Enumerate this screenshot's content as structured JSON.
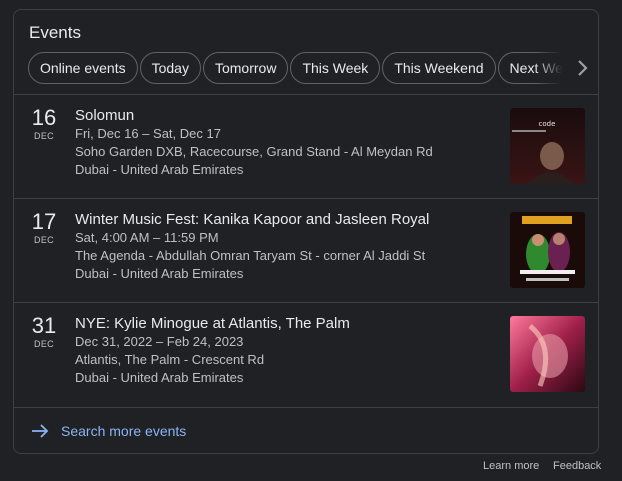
{
  "card": {
    "title": "Events"
  },
  "chips": [
    "Online events",
    "Today",
    "Tomorrow",
    "This Week",
    "This Weekend",
    "Next Week"
  ],
  "events": [
    {
      "day": "16",
      "month": "DEC",
      "title": "Solomun",
      "when": "Fri, Dec 16 – Sat, Dec 17",
      "venue": "Soho Garden DXB, Racecourse, Grand Stand - Al Meydan Rd",
      "city": "Dubai - United Arab Emirates",
      "image_text": "code"
    },
    {
      "day": "17",
      "month": "DEC",
      "title": "Winter Music Fest: Kanika Kapoor and Jasleen Royal",
      "when": "Sat, 4:00 AM – 11:59 PM",
      "venue": "The Agenda - Abdullah Omran Taryam St - corner Al Jaddi St",
      "city": "Dubai - United Arab Emirates"
    },
    {
      "day": "31",
      "month": "DEC",
      "title": "NYE: Kylie Minogue at Atlantis, The Palm",
      "when": "Dec 31, 2022 – Feb 24, 2023",
      "venue": "Atlantis, The Palm - Crescent Rd",
      "city": "Dubai - United Arab Emirates"
    }
  ],
  "search_more": "Search more events",
  "footer": {
    "learn_more": "Learn more",
    "feedback": "Feedback"
  },
  "colors": {
    "background": "#202124",
    "border": "#3c4043",
    "link": "#8ab4f8",
    "text": "#e8eaed",
    "muted": "#bdc1c6"
  }
}
